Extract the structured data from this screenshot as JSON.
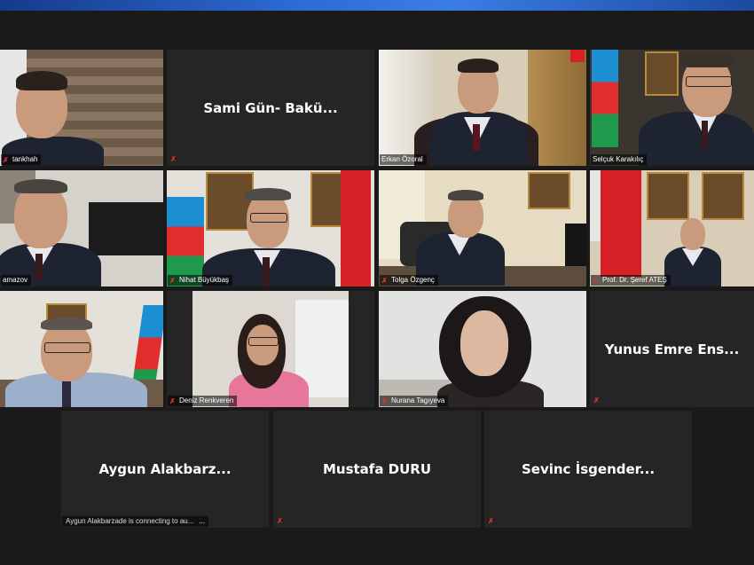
{
  "meeting": {
    "tiles": [
      {
        "id": "t1",
        "name": "tankhah",
        "type": "video",
        "muted": true
      },
      {
        "id": "t2",
        "name": "Sami Gün- Bakü...",
        "type": "name",
        "muted": true
      },
      {
        "id": "t3",
        "name": "Erkan Özoral",
        "type": "video",
        "muted": true
      },
      {
        "id": "t4",
        "name": "Selçuk Karakılıç",
        "type": "video",
        "muted": true
      },
      {
        "id": "t5",
        "name": "amazov",
        "type": "video",
        "muted": false
      },
      {
        "id": "t6",
        "name": "Nihat Büyükbaş",
        "type": "video",
        "muted": true
      },
      {
        "id": "t7",
        "name": "Tolga  Özgenç",
        "type": "video",
        "muted": true
      },
      {
        "id": "t8",
        "name": "Prof. Dr. Şeref ATEŞ",
        "type": "video",
        "muted": true
      },
      {
        "id": "t9",
        "name": "",
        "type": "video",
        "muted": false,
        "active": true
      },
      {
        "id": "t10",
        "name": "Deniz Renkveren",
        "type": "video",
        "muted": true
      },
      {
        "id": "t11",
        "name": "Nurana Tagıyeva",
        "type": "video",
        "muted": true
      },
      {
        "id": "t12",
        "name": "Yunus Emre Ens...",
        "type": "name",
        "muted": true
      },
      {
        "id": "t13",
        "name": "Aygun  Alakbarz...",
        "type": "name",
        "muted": false,
        "status": "Aygun Alakbarzade is connecting to au...",
        "status_dots": "..."
      },
      {
        "id": "t14",
        "name": "Mustafa DURU",
        "type": "name",
        "muted": true
      },
      {
        "id": "t15",
        "name": "Sevinc  İsgender...",
        "type": "name",
        "muted": true
      }
    ]
  },
  "icons": {
    "muted": "muted-mic-icon"
  },
  "colors": {
    "active_speaker": "#c8d84a",
    "muted": "#e0332b"
  }
}
